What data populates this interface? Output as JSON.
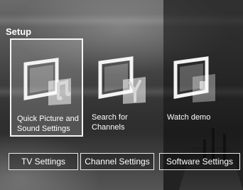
{
  "screen": {
    "title": "Setup"
  },
  "tiles": [
    {
      "label": "Quick Picture and Sound Settings",
      "icon": "music-note-icon"
    },
    {
      "label": "Search for Channels",
      "icon": "antenna-icon"
    },
    {
      "label": "Watch demo",
      "icon": "demo-screen-icon"
    }
  ],
  "buttons": {
    "tv_settings": "TV Settings",
    "channel_settings": "Channel Settings",
    "software_settings": "Software Settings"
  }
}
